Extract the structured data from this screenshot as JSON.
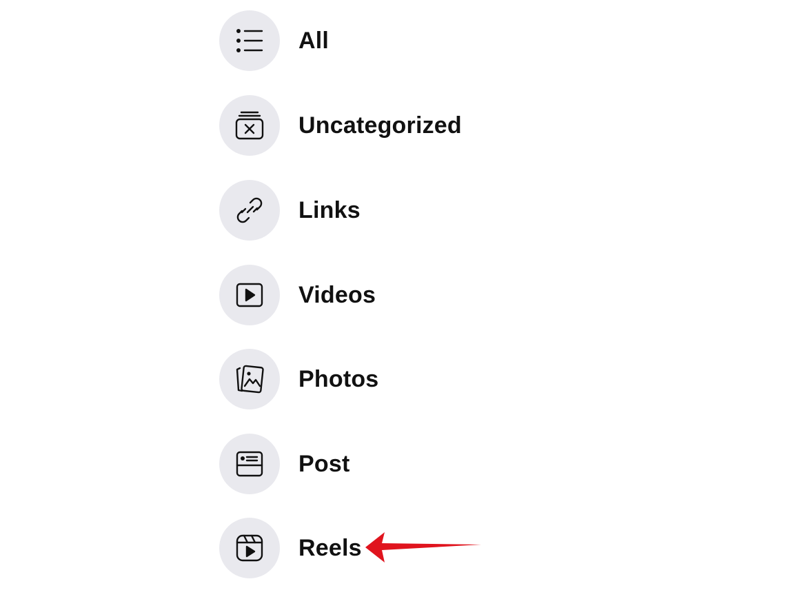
{
  "menu": {
    "items": [
      {
        "label": "All",
        "icon": "list-icon"
      },
      {
        "label": "Uncategorized",
        "icon": "uncategorized-icon"
      },
      {
        "label": "Links",
        "icon": "link-icon"
      },
      {
        "label": "Videos",
        "icon": "video-play-icon"
      },
      {
        "label": "Photos",
        "icon": "photos-icon"
      },
      {
        "label": "Post",
        "icon": "post-icon"
      },
      {
        "label": "Reels",
        "icon": "reels-icon"
      }
    ]
  },
  "annotation": {
    "type": "arrow",
    "color": "#e0141e",
    "points_to": "Reels"
  },
  "colors": {
    "icon_background": "#e9e9ee",
    "text": "#111111",
    "background": "#ffffff"
  }
}
